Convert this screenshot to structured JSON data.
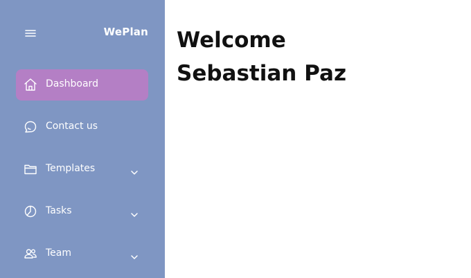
{
  "sidebar": {
    "brand": "WePlan",
    "menu_icon": "hamburger-menu-icon",
    "items": [
      {
        "label": "Dashboard",
        "icon": "home-icon",
        "active": true,
        "has_submenu": false
      },
      {
        "label": "Contact us",
        "icon": "chat-bubble-icon",
        "active": false,
        "has_submenu": false
      },
      {
        "label": "Templates",
        "icon": "folder-icon",
        "active": false,
        "has_submenu": true
      },
      {
        "label": "Tasks",
        "icon": "pie-chart-icon",
        "active": false,
        "has_submenu": true
      },
      {
        "label": "Team",
        "icon": "users-icon",
        "active": false,
        "has_submenu": true
      }
    ]
  },
  "main": {
    "welcome_line1": "Welcome",
    "welcome_line2": "Sebastian Paz"
  },
  "colors": {
    "sidebar_bg": "#7f96c3",
    "active_item_bg": "#b47fc5",
    "text_light": "#ffffff",
    "heading_text": "#111111"
  }
}
